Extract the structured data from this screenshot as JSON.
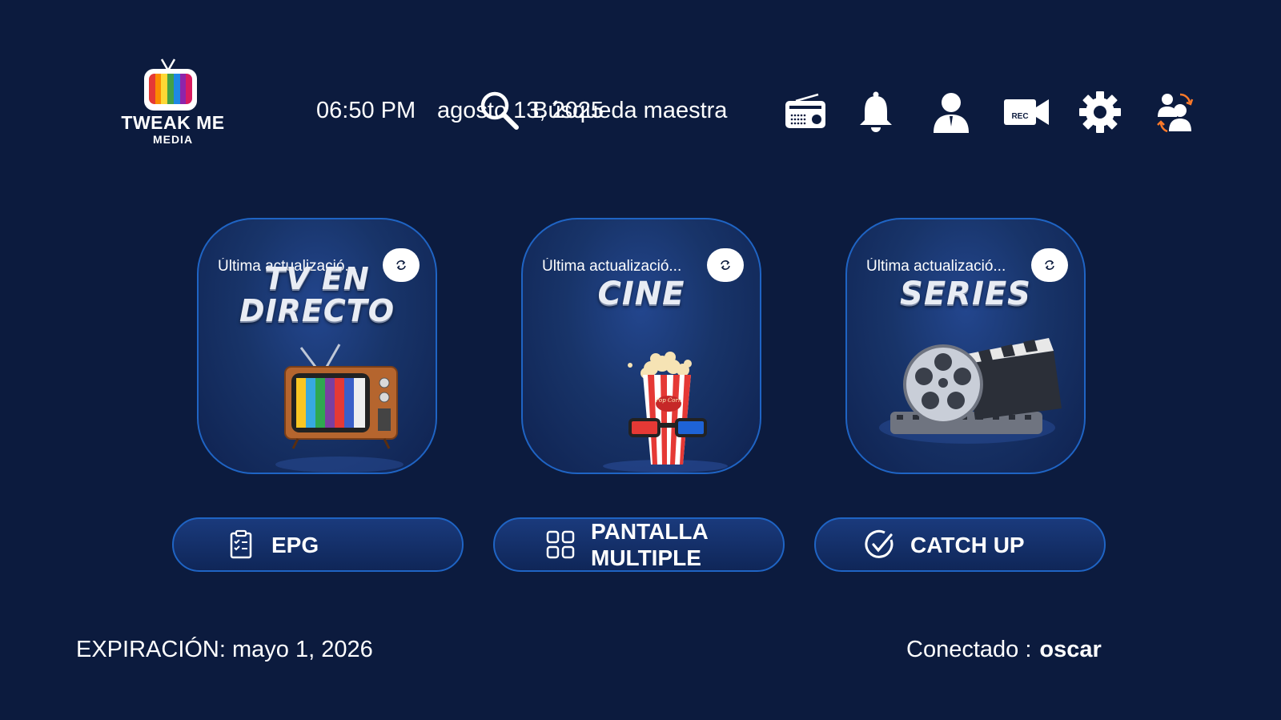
{
  "brand": {
    "line1": "TWEAK ME",
    "line2": "MEDIA",
    "stripe_colors": [
      "#e53935",
      "#fb8c00",
      "#fdd835",
      "#43a047",
      "#1e88e5",
      "#8e24aa",
      "#d81b60"
    ]
  },
  "header": {
    "time": "06:50 PM",
    "date": "agosto 13, 2025",
    "search_label": "Búsqueda maestra",
    "icons": [
      "radio-icon",
      "bell-icon",
      "user-icon",
      "rec-camera-icon",
      "gear-icon",
      "switch-user-icon"
    ],
    "rec_label": "REC"
  },
  "cards": [
    {
      "id": "live",
      "update": "Última actualizació...",
      "title_l1": "TV EN",
      "title_l2": "DIRECTO"
    },
    {
      "id": "movies",
      "update": "Última actualizació...",
      "title_l1": "CINE",
      "title_l2": ""
    },
    {
      "id": "series",
      "update": "Última actualizació...",
      "title_l1": "SERIES",
      "title_l2": ""
    }
  ],
  "buttons": [
    {
      "label_l1": "EPG",
      "label_l2": "",
      "icon": "clipboard-check-icon"
    },
    {
      "label_l1": "PANTALLA",
      "label_l2": "MULTIPLE",
      "icon": "grid-icon"
    },
    {
      "label_l1": "CATCH UP",
      "label_l2": "",
      "icon": "check-circle-icon"
    }
  ],
  "popcorn_text": "Pop Corn",
  "footer": {
    "expiry": "EXPIRACIÓN: mayo 1, 2026",
    "connected_label": "Conectado :",
    "user": "oscar"
  },
  "colors": {
    "background": "#0c1b3e",
    "accent_border": "#1f64c4"
  }
}
